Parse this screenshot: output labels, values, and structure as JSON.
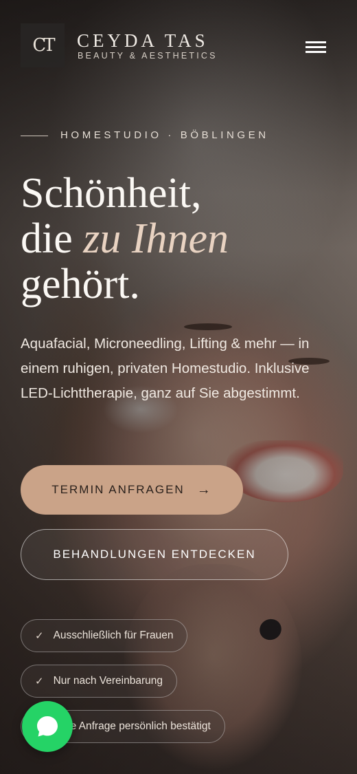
{
  "brand": {
    "monogram": "CT",
    "name": "CEYDA TAS",
    "tagline": "BEAUTY & AESTHETICS"
  },
  "header": {
    "menu_icon": "hamburger-menu-icon"
  },
  "hero": {
    "eyebrow": "HOMESTUDIO · BÖBLINGEN",
    "headline_line1": "Schönheit,",
    "headline_line2_prefix": "die ",
    "headline_line2_emphasis": "zu Ihnen",
    "headline_line3": "gehört.",
    "lede": "Aquafacial, Microneedling, Lifting & mehr — in einem ruhigen, privaten Homestudio. Inklusive LED-Lichttherapie, ganz auf Sie abgestimmt."
  },
  "actions": {
    "primary_label": "TERMIN ANFRAGEN",
    "primary_icon": "arrow-right-icon",
    "secondary_label": "BEHANDLUNGEN ENTDECKEN"
  },
  "features": [
    {
      "label": "Ausschließlich für Frauen",
      "icon": "check-icon"
    },
    {
      "label": "Nur nach Vereinbarung",
      "icon": "check-icon"
    },
    {
      "label": "Jede Anfrage persönlich bestätigt",
      "icon": "check-icon"
    }
  ],
  "chat": {
    "icon": "whatsapp-chat-icon",
    "color": "#25d366"
  },
  "colors": {
    "accent": "#caa388",
    "headline": "#fbf8f4",
    "emphasis": "#e9d3c2"
  }
}
